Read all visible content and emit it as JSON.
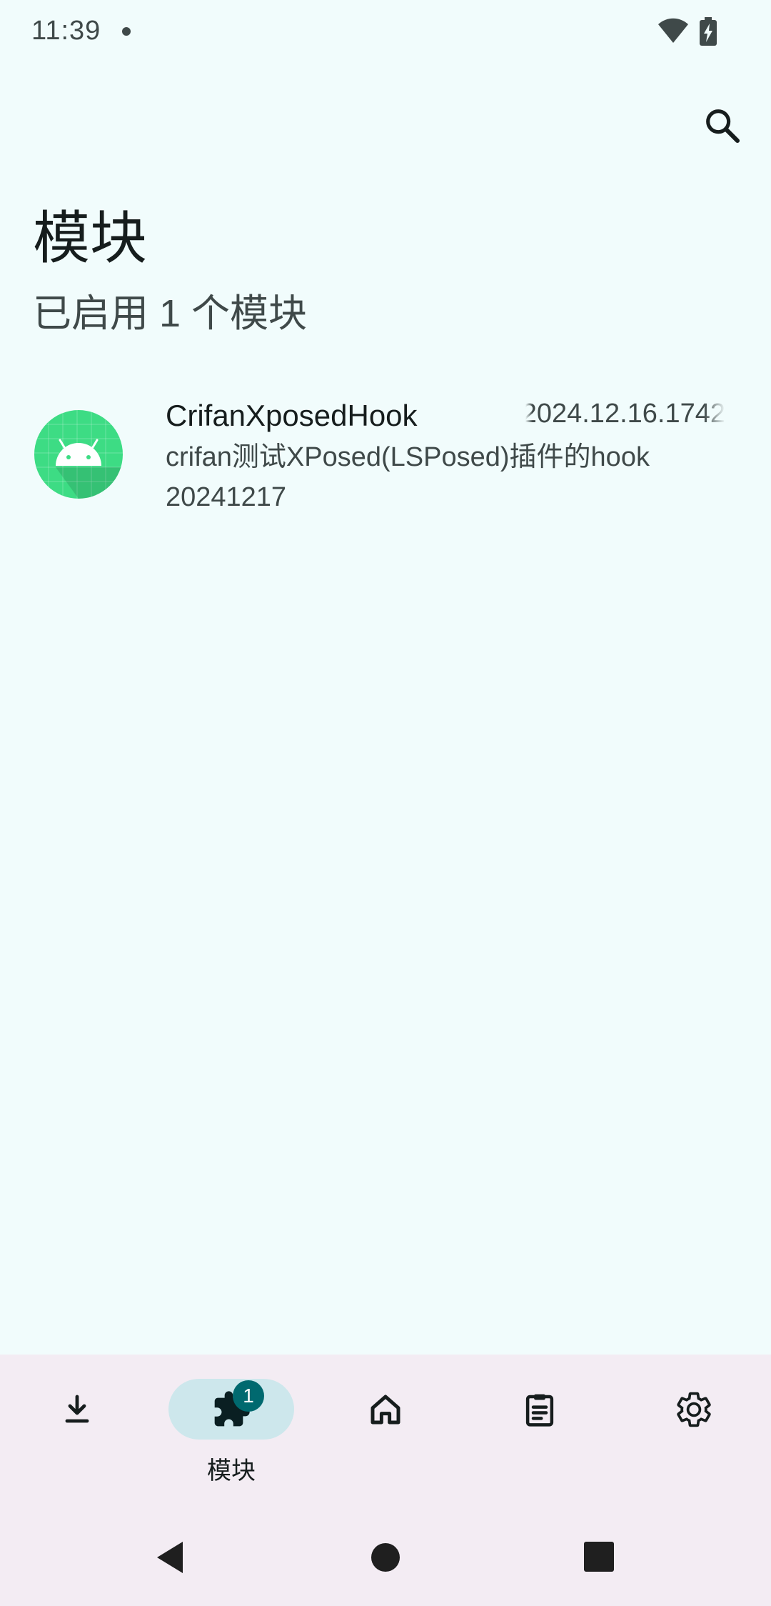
{
  "status_bar": {
    "time": "11:39",
    "icons": [
      "notification-dot-icon",
      "wifi-icon",
      "battery-charging-icon"
    ]
  },
  "toolbar": {
    "search_icon": "search-icon"
  },
  "header": {
    "title": "模块",
    "subtitle": "已启用 1 个模块"
  },
  "modules": [
    {
      "icon": "android-app-icon",
      "name": "CrifanXposedHook",
      "version": "2024.12.16.1742",
      "description": "crifan测试XPosed(LSPosed)插件的hook 20241217"
    }
  ],
  "bottom_nav": {
    "items": [
      {
        "icon": "download-icon",
        "label": ""
      },
      {
        "icon": "extension-icon",
        "label": "模块",
        "badge": "1",
        "active": true
      },
      {
        "icon": "home-icon",
        "label": ""
      },
      {
        "icon": "logs-icon",
        "label": ""
      },
      {
        "icon": "settings-icon",
        "label": ""
      }
    ]
  },
  "system_nav": {
    "icons": [
      "back-icon",
      "home-circle-icon",
      "recents-icon"
    ]
  },
  "colors": {
    "background": "#f1fcfc",
    "nav_background": "#f3ecf3",
    "active_indicator": "#cde7ec",
    "badge": "#00696f",
    "app_icon_green": "#3ddc84"
  }
}
